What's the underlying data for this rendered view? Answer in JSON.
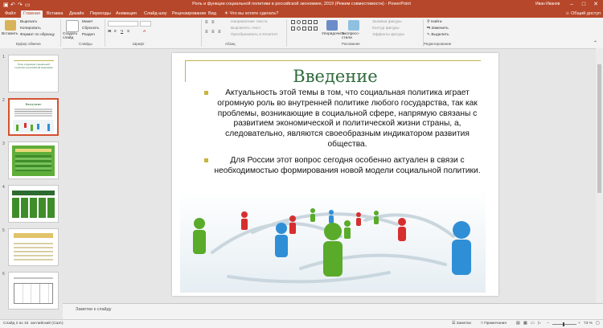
{
  "window": {
    "title": "Роль и функции социальной политики в российской экономике, 2019 (Режим совместимости) - PowerPoint",
    "user": "Иван Иванов",
    "min_icon": "minimize-icon",
    "max_icon": "restore-icon",
    "close_icon": "close-icon"
  },
  "quick_access": {
    "save_icon": "save-icon",
    "undo_icon": "undo-icon",
    "redo_icon": "redo-icon",
    "present_icon": "present-icon"
  },
  "tabs": [
    {
      "label": "Файл"
    },
    {
      "label": "Главная"
    },
    {
      "label": "Вставка"
    },
    {
      "label": "Дизайн"
    },
    {
      "label": "Переходы"
    },
    {
      "label": "Анимация"
    },
    {
      "label": "Слайд-шоу"
    },
    {
      "label": "Рецензирование"
    },
    {
      "label": "Вид"
    },
    {
      "label": "Что вы хотите сделать?"
    }
  ],
  "share_label": "Общий доступ",
  "ribbon": {
    "paste": "Вставить",
    "cut": "Вырезать",
    "copy": "Копировать",
    "format_painter": "Формат по образцу",
    "clipboard_group": "Буфер обмена",
    "new_slide": "Создать слайд",
    "layout": "Макет",
    "reset": "Сбросить",
    "section": "Раздел",
    "slides_group": "Слайды",
    "font_group": "Шрифт",
    "paragraph_group": "Абзац",
    "text_direction": "Направление текста",
    "align_text": "Выровнять текст",
    "convert_smartart": "Преобразовать в SmartArt",
    "drawing_group": "Рисование",
    "arrange": "Упорядочить",
    "quick_styles": "Экспресс-стили",
    "shape_fill": "Заливка фигуры",
    "shape_outline": "Контур фигуры",
    "shape_effects": "Эффекты фигуры",
    "find": "Найти",
    "replace": "Заменить",
    "select": "Выделить",
    "editing_group": "Редактирование"
  },
  "thumbnails": [
    {
      "num": "1",
      "text": "Роль и функции социальной политики в российской экономике"
    },
    {
      "num": "2",
      "text": "Введение"
    },
    {
      "num": "3",
      "text": ""
    },
    {
      "num": "4",
      "text": ""
    },
    {
      "num": "5",
      "text": ""
    },
    {
      "num": "6",
      "text": ""
    }
  ],
  "slide": {
    "title": "Введение",
    "bullets": [
      "Актуальность этой темы в том, что социальная политика играет огромную роль во внутренней политике любого государства, так как проблемы, возникающие в социальной сфере, напрямую связаны с развитием экономической и политической жизни страны, а, следовательно, являются своеобразным индикатором развития общества.",
      "Для России этот вопрос сегодня особенно актуален в связи с необходимостью формирования новой модели социальной политики."
    ]
  },
  "notes_placeholder": "Заметки к слайду",
  "status": {
    "slide_counter": "Слайд 2 из 15",
    "language": "английский (США)",
    "notes_label": "Заметки",
    "comments_label": "Примечания",
    "zoom": "73 %"
  },
  "colors": {
    "accent": "#b7472a",
    "title_green": "#2f6b3c",
    "bullet_gold": "#c9b540",
    "figure_green": "#5aab2a",
    "figure_blue": "#2f8fd6",
    "figure_red": "#d62f2f"
  }
}
